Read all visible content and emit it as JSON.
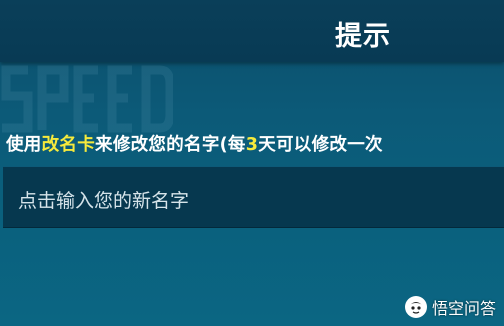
{
  "dialog": {
    "title": "提示"
  },
  "notice": {
    "part1": "使用",
    "item_name": "改名卡",
    "part2": "来修改您的名字(每",
    "days": "3",
    "part3": "天可以修改一次"
  },
  "name_input": {
    "placeholder": "点击输入您的新名字"
  },
  "watermark": {
    "brand_label": "悟空问答"
  },
  "colors": {
    "highlight": "#f6ea3c",
    "header_bg": "#083a54",
    "input_bg": "#06384f"
  },
  "icons": {
    "brand_logo": "wukong-logo-icon",
    "background_decoration": "speed-decoration"
  }
}
